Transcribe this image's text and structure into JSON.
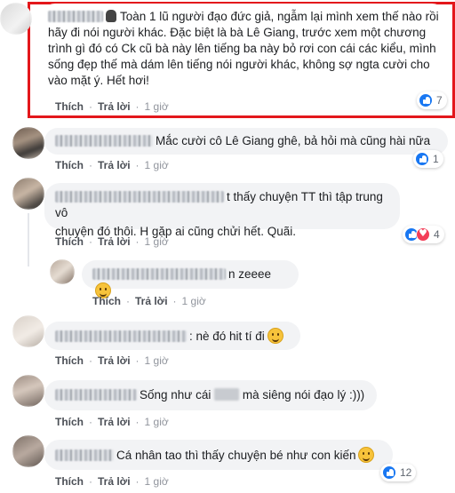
{
  "comments": [
    {
      "text": "Toàn 1 lũ người đạo đức giả, ngẫm lại mình xem thế nào rồi hãy đi nói người khác. Đặc biệt là bà Lê Giang, trước xem một chương trình gì đó có Ck cũ bà này lên tiếng ba này bỏ rơi con cái các kiểu, mình sống đẹp thế mà dám lên tiếng nói người khác, không sợ ngta cười cho vào mặt ý. Hết hơi!",
      "like": "Thích",
      "reply": "Trả lời",
      "time": "1 giờ",
      "reactions": "7"
    },
    {
      "text": "Mắc cười cô Lê Giang ghê, bả hỏi mà cũng hài nữa",
      "like": "Thích",
      "reply": "Trả lời",
      "time": "1 giờ",
      "reactions": "1"
    },
    {
      "text_line1": "t thấy chuyện TT thì tập trung vô",
      "text_line2": "chuyện đó thôi. H gặp ai cũng chửi hết. Quãi.",
      "like": "Thích",
      "reply": "Trả lời",
      "time": "1 giờ",
      "reactions": "4"
    },
    {
      "text": "n zeeee",
      "like": "Thích",
      "reply": "Trả lời",
      "time": "1 giờ"
    },
    {
      "text": ": nè đó hit tí đi",
      "like": "Thích",
      "reply": "Trả lời",
      "time": "1 giờ"
    },
    {
      "text_before": "Sống như cái",
      "text_after": "mà siêng nói đạo lý :)))",
      "like": "Thích",
      "reply": "Trả lời",
      "time": "1 giờ"
    },
    {
      "text": "Cá nhân tao thì thấy chuyện bé như con kiến",
      "like": "Thích",
      "reply": "Trả lời",
      "time": "1 giờ",
      "reactions": "12"
    }
  ],
  "colors": {
    "highlight_border": "#e3171b",
    "bubble": "#f2f3f5",
    "like_blue": "#1877f2",
    "love_red": "#f33e58"
  },
  "icons": [
    "wave-hand-icon",
    "like-icon",
    "love-icon",
    "smiley-emoji-icon"
  ]
}
